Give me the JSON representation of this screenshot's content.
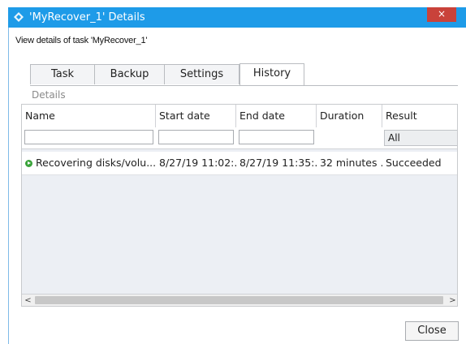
{
  "window": {
    "title": "'MyRecover_1' Details",
    "close_glyph": "×",
    "subtitle": "View details of task 'MyRecover_1'"
  },
  "tabs": [
    {
      "label": "Task",
      "active": false
    },
    {
      "label": "Backup",
      "active": false
    },
    {
      "label": "Settings",
      "active": false
    },
    {
      "label": "History",
      "active": true
    }
  ],
  "details_label": "Details",
  "table": {
    "columns": [
      "Name",
      "Start date",
      "End date",
      "Duration",
      "Result"
    ],
    "filters": {
      "name": "",
      "start_date": "",
      "end_date": "",
      "result_selected": "All"
    },
    "rows": [
      {
        "status": "succeeded-icon",
        "name": "Recovering disks/volu...",
        "start_date": "8/27/19 11:02:...",
        "end_date": "8/27/19 11:35:...",
        "duration": "32 minutes ...",
        "result": "Succeeded"
      }
    ]
  },
  "scrollbar": {
    "left_arrow": "<",
    "right_arrow": ">"
  },
  "footer": {
    "close_label": "Close"
  },
  "colors": {
    "titlebar": "#1e9be8",
    "close": "#c9423a",
    "status_ok": "#3aa33a"
  }
}
